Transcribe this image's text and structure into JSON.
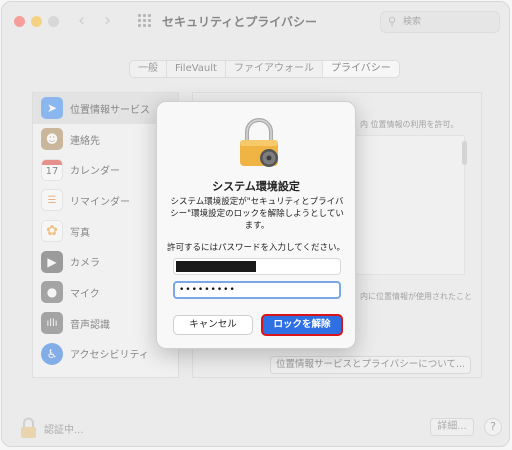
{
  "window": {
    "title": "セキュリティとプライバシー",
    "search_placeholder": "検索"
  },
  "tabs": [
    {
      "label": "一般"
    },
    {
      "label": "FileVault"
    },
    {
      "label": "ファイアウォール"
    },
    {
      "label": "プライバシー",
      "active": true
    }
  ],
  "sidebar": {
    "items": [
      {
        "label": "位置情報サービス",
        "icon": "location-arrow-icon",
        "color": "#3d8cf5"
      },
      {
        "label": "連絡先",
        "icon": "contacts-icon",
        "color": "#b08a5a"
      },
      {
        "label": "カレンダー",
        "icon": "calendar-icon",
        "color": "#ffffff"
      },
      {
        "label": "リマインダー",
        "icon": "reminders-icon",
        "color": "#ffffff"
      },
      {
        "label": "写真",
        "icon": "photos-icon",
        "color": "#f0a030"
      },
      {
        "label": "カメラ",
        "icon": "camera-icon",
        "color": "#5a5a5a"
      },
      {
        "label": "マイク",
        "icon": "microphone-icon",
        "color": "#6a6a6a"
      },
      {
        "label": "音声認識",
        "icon": "speech-recognition-icon",
        "color": "#6a6a6a"
      },
      {
        "label": "アクセシビリティ",
        "icon": "accessibility-icon",
        "color": "#2f7ae5"
      }
    ],
    "calendar_day": "17"
  },
  "pane": {
    "description": "内 位置情報の利用を許可。",
    "description2": "内に位置情報が使用されたこと",
    "about_button": "位置情報サービスとプライバシーについて..."
  },
  "bottom": {
    "auth_text": "認証中...",
    "detail_button": "詳細...",
    "help_button": "?"
  },
  "dialog": {
    "title": "システム環境設定",
    "message": "システム環境設定が\"セキュリティとプライバシー\"環境設定のロックを解除しようとしています。",
    "prompt": "許可するにはパスワードを入力してください。",
    "password_value": "•••••••••",
    "cancel_label": "キャンセル",
    "unlock_label": "ロックを解除"
  },
  "colors": {
    "accent": "#2f6fe4",
    "highlight_border": "#d9141a",
    "focus_ring": "#7aa8e6"
  }
}
